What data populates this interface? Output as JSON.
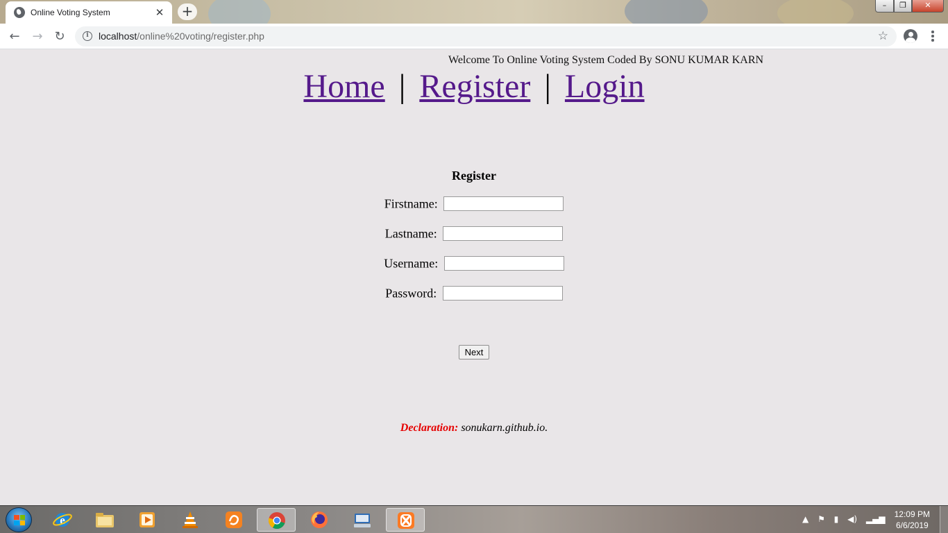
{
  "browser": {
    "tab_title": "Online Voting System",
    "tab_close": "✕",
    "new_tab": "+",
    "url_host": "localhost",
    "url_path": "/online%20voting/register.php",
    "back": "←",
    "forward": "→",
    "reload": "↻",
    "window_minimize": "–",
    "window_maximize": "❐",
    "window_close": "✕",
    "bookmark_star": "☆"
  },
  "page": {
    "welcome": "Welcome To Online Voting System Coded By SONU KUMAR KARN",
    "nav": {
      "home": "Home",
      "register": "Register",
      "login": "Login",
      "separator": "|"
    },
    "form": {
      "title": "Register",
      "fields": [
        {
          "label": "Firstname:",
          "value": ""
        },
        {
          "label": "Lastname:",
          "value": ""
        },
        {
          "label": "Username:",
          "value": ""
        },
        {
          "label": "Password:",
          "value": ""
        }
      ],
      "submit": "Next"
    },
    "declaration": {
      "label": "Declaration:",
      "text": "sonukarn.github.io."
    }
  },
  "taskbar": {
    "apps": [
      "start",
      "internet-explorer",
      "file-explorer",
      "media-player",
      "vlc",
      "uc-browser",
      "chrome",
      "firefox",
      "on-screen-keyboard",
      "xampp"
    ],
    "active_app": "chrome",
    "clock_time": "12:09 PM",
    "clock_date": "6/6/2019"
  },
  "colors": {
    "page_background": "#e9e6e8",
    "link_visited": "#551a8b",
    "declaration_label": "#e60000"
  }
}
